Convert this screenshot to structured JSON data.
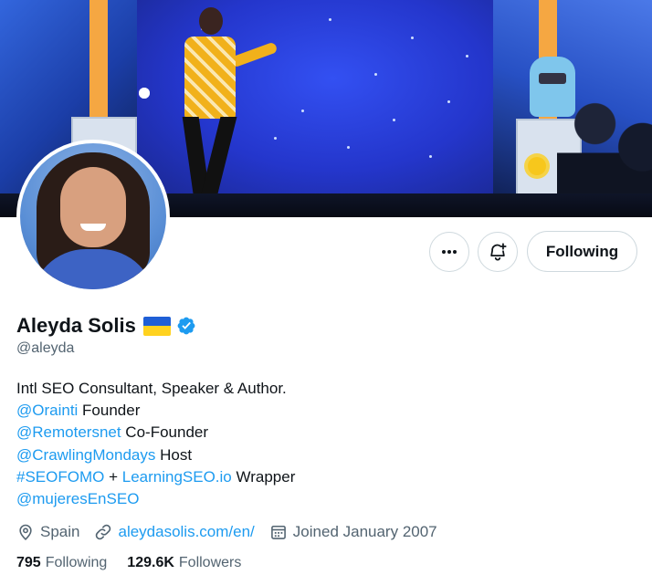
{
  "profile": {
    "name": "Aleyda Solis",
    "handle": "@aleyda",
    "flag_icon": "ukraine-flag",
    "verified_icon": "verified-badge-icon",
    "accent_color": "#1d9bf0"
  },
  "actions": {
    "more_icon": "more-icon",
    "notify_icon": "bell-plus-icon",
    "follow_label": "Following"
  },
  "bio": {
    "line1": "Intl SEO Consultant, Speaker & Author.",
    "line2_link": "@Orainti",
    "line2_text": " Founder",
    "line3_link": "@Remotersnet",
    "line3_text": " Co-Founder",
    "line4_link": "@CrawlingMondays",
    "line4_text": " Host",
    "line5_link1": "#SEOFOMO",
    "line5_mid": " + ",
    "line5_link2": "LearningSEO.io",
    "line5_text": " Wrapper",
    "line6_link": "@mujeresEnSEO"
  },
  "meta": {
    "location": "Spain",
    "website": "aleydasolis.com/en/",
    "joined": "Joined January 2007"
  },
  "counts": {
    "following_num": "795",
    "following_label": "Following",
    "followers_num": "129.6K",
    "followers_label": "Followers"
  }
}
